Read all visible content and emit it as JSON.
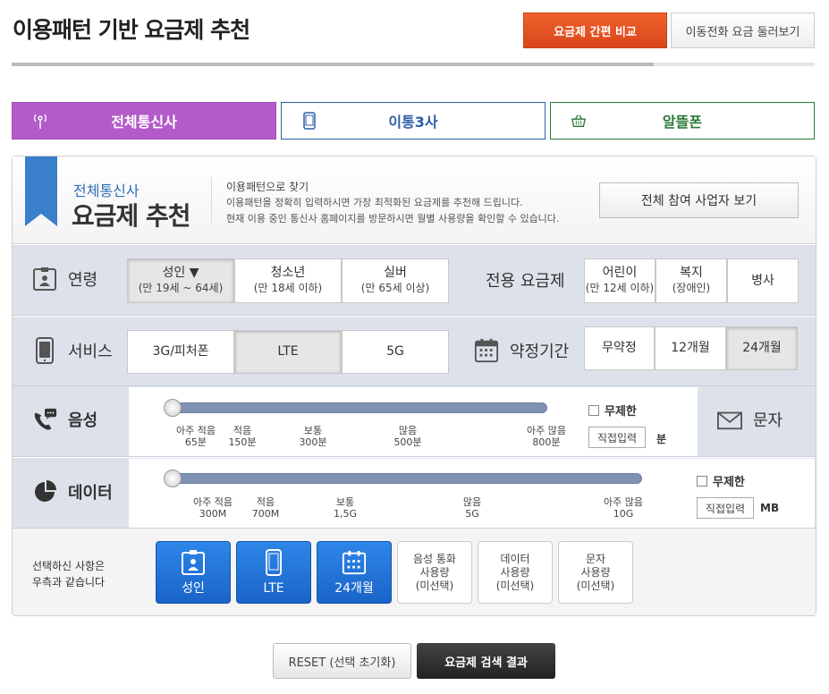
{
  "page": {
    "title": "이용패턴 기반 요금제 추천",
    "compare_button": "요금제 간편 비교",
    "browse_button": "이동전화 요금 둘러보기",
    "progress_fraction": 0.8
  },
  "tabs": [
    {
      "label": "전체통신사",
      "icon": "antenna-icon",
      "active": true
    },
    {
      "label": "이통3사",
      "icon": "phone-icon",
      "active": false
    },
    {
      "label": "알뜰폰",
      "icon": "basket-icon",
      "active": false
    }
  ],
  "header": {
    "subtitle": "전체통신사",
    "title": "요금제 추천",
    "desc_title": "이용패턴으로 찾기",
    "desc_line1": "이용패턴을 정확히 입력하시면 가장 최적화된 요금제를 추천해 드립니다.",
    "desc_line2": "현재 이용 중인 통신사 홈페이지를 방문하시면 월별 사용량을 확인할 수 있습니다.",
    "all_carriers_button": "전체 참여 사업자 보기"
  },
  "age": {
    "label": "연령",
    "options": [
      {
        "name": "성인 ▼",
        "sub": "(만 19세 ~ 64세)",
        "selected": true
      },
      {
        "name": "청소년",
        "sub": "(만 18세 이하)",
        "selected": false
      },
      {
        "name": "실버",
        "sub": "(만 65세 이상)",
        "selected": false
      }
    ]
  },
  "special": {
    "label": "전용 요금제",
    "options": [
      {
        "name": "어린이",
        "sub": "(만 12세 이하)"
      },
      {
        "name": "복지",
        "sub": "(장애인)"
      },
      {
        "name": "병사",
        "sub": ""
      }
    ]
  },
  "service": {
    "label": "서비스",
    "options": [
      {
        "name": "3G/피처폰",
        "selected": false
      },
      {
        "name": "LTE",
        "selected": true
      },
      {
        "name": "5G",
        "selected": false
      }
    ]
  },
  "contract": {
    "label": "약정기간",
    "options": [
      {
        "name": "무약정",
        "selected": false
      },
      {
        "name": "12개월",
        "selected": false
      },
      {
        "name": "24개월",
        "selected": true
      }
    ]
  },
  "voice": {
    "label": "음성",
    "ticks": [
      {
        "l1": "아주 적음",
        "l2": "65분"
      },
      {
        "l1": "적음",
        "l2": "150분"
      },
      {
        "l1": "보통",
        "l2": "300분"
      },
      {
        "l1": "많음",
        "l2": "500분"
      },
      {
        "l1": "아주 많음",
        "l2": "800분"
      }
    ],
    "unlimited": "무제한",
    "direct": "직접입력",
    "unit": "분",
    "sms_label": "문자"
  },
  "data": {
    "label": "데이터",
    "ticks": [
      {
        "l1": "아주 적음",
        "l2": "300M"
      },
      {
        "l1": "적음",
        "l2": "700M"
      },
      {
        "l1": "보통",
        "l2": "1,5G"
      },
      {
        "l1": "많음",
        "l2": "5G"
      },
      {
        "l1": "아주 많음",
        "l2": "10G"
      }
    ],
    "unlimited": "무제한",
    "direct": "직접입력",
    "unit": "MB"
  },
  "summary": {
    "label_line1": "선택하신 사항은",
    "label_line2": "우측과 같습니다",
    "selected": [
      "성인",
      "LTE",
      "24개월"
    ],
    "unselected": [
      {
        "l1": "음성 통화",
        "l2": "사용량",
        "l3": "(미선택)"
      },
      {
        "l1": "데이터",
        "l2": "사용량",
        "l3": "(미선택)"
      },
      {
        "l1": "문자",
        "l2": "사용량",
        "l3": "(미선택)"
      }
    ]
  },
  "actions": {
    "reset": "RESET (선택 초기화)",
    "search": "요금제 검색 결과"
  },
  "colors": {
    "accent_orange": "#e0531f",
    "tab_purple": "#b35bc9",
    "mno_blue": "#2d5fa8",
    "mvno_green": "#2c7a3a",
    "summary_blue": "#1a64c8"
  }
}
